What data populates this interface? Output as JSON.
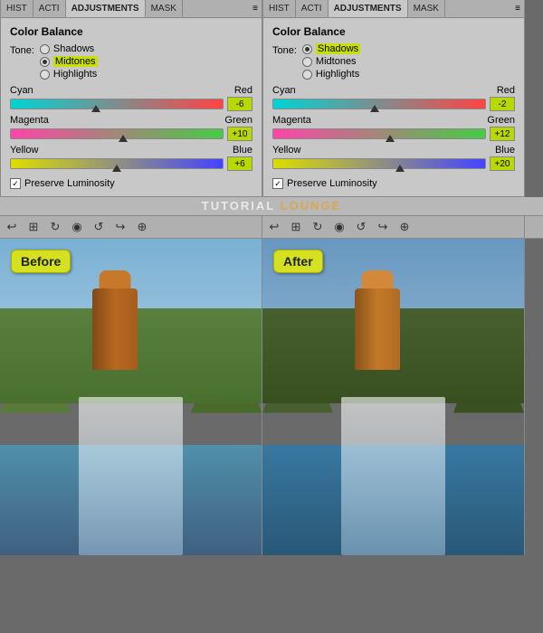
{
  "left_panel": {
    "tabs": [
      "HIST",
      "ACTI",
      "ADJUSTMENTS",
      "MASK"
    ],
    "active_tab": "ADJUSTMENTS",
    "title": "Color Balance",
    "tone_label": "Tone:",
    "tones": [
      {
        "id": "shadows",
        "label": "Shadows",
        "selected": false
      },
      {
        "id": "midtones",
        "label": "Midtones",
        "selected": true,
        "highlight": true
      },
      {
        "id": "highlights",
        "label": "Highlights",
        "selected": false
      }
    ],
    "sliders": [
      {
        "left": "Cyan",
        "right": "Red",
        "value": "-6",
        "position": 40,
        "gradient": "cyan-red"
      },
      {
        "left": "Magenta",
        "right": "Green",
        "value": "+10",
        "position": 55,
        "gradient": "magenta-green"
      },
      {
        "left": "Yellow",
        "right": "Blue",
        "value": "+6",
        "position": 50,
        "gradient": "yellow-blue"
      }
    ],
    "preserve_label": "Preserve Luminosity",
    "preserve_checked": true
  },
  "right_panel": {
    "tabs": [
      "HIST",
      "ACTI",
      "ADJUSTMENTS",
      "MASK"
    ],
    "active_tab": "ADJUSTMENTS",
    "title": "Color Balance",
    "tone_label": "Tone:",
    "tones": [
      {
        "id": "shadows",
        "label": "Shadows",
        "selected": true,
        "highlight": true
      },
      {
        "id": "midtones",
        "label": "Midtones",
        "selected": false
      },
      {
        "id": "highlights",
        "label": "Highlights",
        "selected": false
      }
    ],
    "sliders": [
      {
        "left": "Cyan",
        "right": "Red",
        "value": "-2",
        "position": 47,
        "gradient": "cyan-red"
      },
      {
        "left": "Magenta",
        "right": "Green",
        "value": "+12",
        "position": 56,
        "gradient": "magenta-green"
      },
      {
        "left": "Yellow",
        "right": "Blue",
        "value": "+20",
        "position": 60,
        "gradient": "yellow-blue"
      }
    ],
    "preserve_label": "Preserve Luminosity",
    "preserve_checked": true
  },
  "toolbar": {
    "icons": [
      "↩",
      "⊞",
      "↻",
      "👁",
      "↺",
      "↩",
      "⊕"
    ]
  },
  "images": {
    "before_label": "Before",
    "after_label": "After"
  },
  "watermark": {
    "tutorial": "TUTORIAL",
    "lounge": " LOUNGE"
  }
}
